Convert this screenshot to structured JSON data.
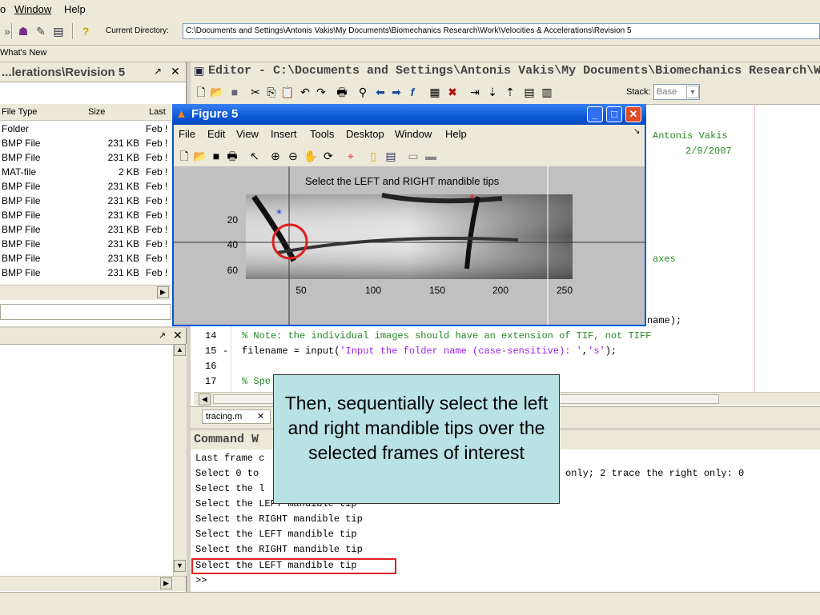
{
  "menubar": {
    "items": [
      "o",
      "Window",
      "Help"
    ]
  },
  "toolbar": {
    "current_dir_label": "Current Directory:",
    "current_dir": "C:\\Documents and Settings\\Antonis Vakis\\My Documents\\Biomechanics Research\\Work\\Velocities & Accelerations\\Revision 5"
  },
  "shortcuts": {
    "whats_new": "What's New"
  },
  "files_panel": {
    "title": "...lerations\\Revision 5",
    "headers": {
      "type": "File Type",
      "size": "Size",
      "last": "Last"
    },
    "rows": [
      {
        "type": "Folder",
        "size": "",
        "last": "Feb !"
      },
      {
        "type": "BMP File",
        "size": "231 KB",
        "last": "Feb !"
      },
      {
        "type": "BMP File",
        "size": "231 KB",
        "last": "Feb !"
      },
      {
        "type": "MAT-file",
        "size": "2 KB",
        "last": "Feb !"
      },
      {
        "type": "BMP File",
        "size": "231 KB",
        "last": "Feb !"
      },
      {
        "type": "BMP File",
        "size": "231 KB",
        "last": "Feb !"
      },
      {
        "type": "BMP File",
        "size": "231 KB",
        "last": "Feb !"
      },
      {
        "type": "BMP File",
        "size": "231 KB",
        "last": "Feb !"
      },
      {
        "type": "BMP File",
        "size": "231 KB",
        "last": "Feb !"
      },
      {
        "type": "BMP File",
        "size": "231 KB",
        "last": "Feb !"
      },
      {
        "type": "BMP File",
        "size": "231 KB",
        "last": "Feb !"
      }
    ]
  },
  "editor": {
    "title": "Editor - C:\\Documents and Settings\\Antonis Vakis\\My Documents\\Biomechanics Research\\Work",
    "stack_label": "Stack:",
    "stack_value": "Base",
    "author_line": "Antonis Vakis",
    "date_line": "2/9/2007",
    "axes_text": "axes",
    "name_text": "name);",
    "lines": [
      {
        "num": "14",
        "dash": "",
        "code": "% Note: the individual images should have an extension of TIF, not TIFF",
        "kind": "comment"
      },
      {
        "num": "15",
        "dash": "-",
        "code": "filename = input(",
        "str": "'Input the folder name (case-sensitive): '",
        "rest": ",",
        "str2": "'s'",
        "end": ");",
        "kind": "mixed"
      },
      {
        "num": "16",
        "dash": "",
        "code": "",
        "kind": "plain"
      },
      {
        "num": "17",
        "dash": "",
        "code": "% Spe",
        "kind": "comment"
      }
    ],
    "tab": "tracing.m"
  },
  "figure": {
    "title": "Figure 5",
    "menu": [
      "File",
      "Edit",
      "View",
      "Insert",
      "Tools",
      "Desktop",
      "Window",
      "Help"
    ],
    "plot_title": "Select the LEFT and RIGHT mandible tips",
    "xticks": [
      "50",
      "100",
      "150",
      "200",
      "250"
    ],
    "yticks": [
      "20",
      "40",
      "60"
    ]
  },
  "command_window": {
    "title": "Command W",
    "lines": [
      "Last frame c",
      "Select 0 to",
      "Select the l",
      "Select the LEFT mandible tip",
      "Select the RIGHT mandible tip",
      "Select the LEFT mandible tip",
      "Select the RIGHT mandible tip",
      "Select the LEFT mandible tip",
      ">>"
    ],
    "right_text": "only; 2 trace the right only: 0"
  },
  "callout": {
    "text": "Then, sequentially select the left and right mandible tips over the selected frames of interest"
  },
  "colors": {
    "highlight": "#e02020",
    "callout_bg": "#b9e2e4",
    "xp_title": "#0a58d6"
  }
}
